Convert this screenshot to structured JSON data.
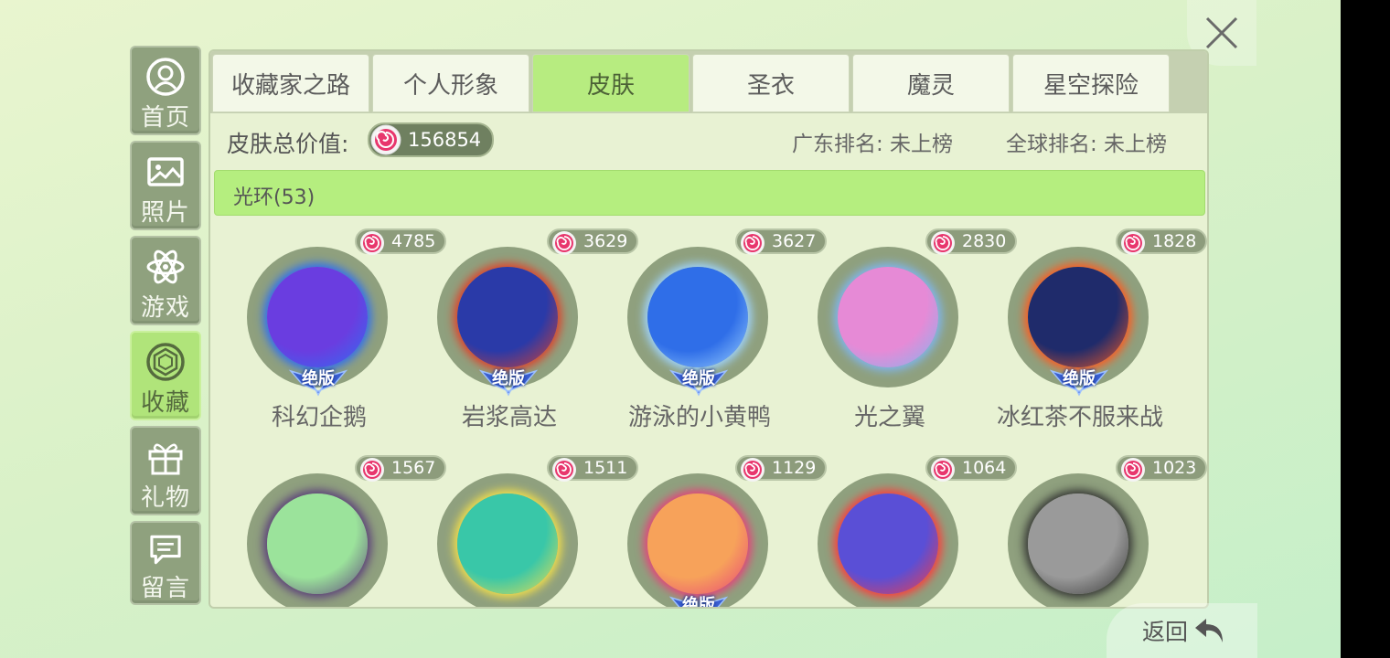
{
  "sidebar": {
    "items": [
      {
        "label": "首页",
        "icon": "user-circle-icon",
        "active": false
      },
      {
        "label": "照片",
        "icon": "photo-icon",
        "active": false
      },
      {
        "label": "游戏",
        "icon": "atom-icon",
        "active": false
      },
      {
        "label": "收藏",
        "icon": "gem-icon",
        "active": true
      },
      {
        "label": "礼物",
        "icon": "gift-icon",
        "active": false
      },
      {
        "label": "留言",
        "icon": "message-icon",
        "active": false
      }
    ]
  },
  "tabs": [
    {
      "label": "收藏家之路",
      "active": false
    },
    {
      "label": "个人形象",
      "active": false
    },
    {
      "label": "皮肤",
      "active": true
    },
    {
      "label": "圣衣",
      "active": false
    },
    {
      "label": "魔灵",
      "active": false
    },
    {
      "label": "星空探险",
      "active": false
    }
  ],
  "summary": {
    "total_label": "皮肤总价值:",
    "total_value": "156854",
    "rank_guangdong": "广东排名: 未上榜",
    "rank_global": "全球排名: 未上榜"
  },
  "section": {
    "title": "光环(53)"
  },
  "items": [
    {
      "name": "科幻企鹅",
      "price": "4785",
      "badge": "绝版",
      "colors": [
        "#6a3de0",
        "#2e6ff2"
      ]
    },
    {
      "name": "岩浆高达",
      "price": "3629",
      "badge": "绝版",
      "colors": [
        "#2a3aa8",
        "#e0402a"
      ]
    },
    {
      "name": "游泳的小黄鸭",
      "price": "3627",
      "badge": "绝版",
      "colors": [
        "#2f6ee8",
        "#9fd4ff"
      ]
    },
    {
      "name": "光之翼",
      "price": "2830",
      "badge": "",
      "colors": [
        "#e68ad6",
        "#7fb6f0"
      ]
    },
    {
      "name": "冰红茶不服来战",
      "price": "1828",
      "badge": "绝版",
      "colors": [
        "#1f2b6b",
        "#ff5a1f"
      ]
    },
    {
      "name": "",
      "price": "1567",
      "badge": "",
      "colors": [
        "#9be39b",
        "#5a3d7a"
      ]
    },
    {
      "name": "",
      "price": "1511",
      "badge": "",
      "colors": [
        "#39c7a8",
        "#f4e04a"
      ]
    },
    {
      "name": "",
      "price": "1129",
      "badge": "绝版",
      "colors": [
        "#f7a25a",
        "#e8407a"
      ]
    },
    {
      "name": "",
      "price": "1064",
      "badge": "",
      "colors": [
        "#5a4fd6",
        "#ff3b3b"
      ]
    },
    {
      "name": "",
      "price": "1023",
      "badge": "",
      "colors": [
        "#9a9a9a",
        "#333333"
      ]
    }
  ],
  "footer": {
    "back_label": "返回"
  }
}
